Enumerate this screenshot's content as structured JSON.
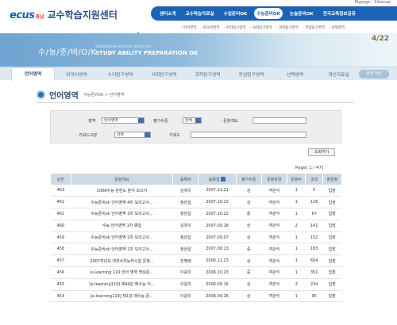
{
  "top_links": [
    "Mypage",
    "Sitemap"
  ],
  "logo": {
    "brand": "ecus",
    "region": "충남",
    "center": "교수학습지원센터"
  },
  "main_nav": [
    "센터소개",
    "교수학습자료실",
    "수업준비OK",
    "수능준비OK",
    "논술준비OK",
    "전국교육정보공유"
  ],
  "main_nav_active": 3,
  "sub_nav": [
    "· 언어영역",
    "· 외국어영역",
    "· 수리탐구영역",
    "· 사회탐구영역",
    "· 과학탐구영역",
    "· 직업탐구영역",
    "· 선택영역"
  ],
  "banner": {
    "ko": "수/능/준/비/O/K",
    "en_small": "Standardized scholastic ability test",
    "en": "STUDY ABILITY PREPARATION OK",
    "math": "4/22"
  },
  "tabs": [
    "언어영역",
    "외국어영역",
    "수리탐구영역",
    "사회탐구영역",
    "과학탐구영역",
    "직업탐구영역",
    "선택영역",
    "개인자료실"
  ],
  "tab_active": 0,
  "write_button": "문항 작성",
  "page_title": "언어영역",
  "breadcrumb": "수능준비OK > 언어영역",
  "search": {
    "area_label": "· 영역",
    "area_value": "언어영역",
    "level_label": "· 평가수준",
    "level_value": "전체",
    "summary_label": "· 문항개요",
    "keyword_type_label": "· 키워드구분",
    "keyword_type_value": "선택",
    "keyword_label": "· 키워드",
    "submit": "조회하기"
  },
  "page_info": "Page[ 1 / 47]",
  "table": {
    "headers": [
      "순번",
      "문항개요",
      "등록자",
      "등록일",
      "평가수준",
      "문항유형",
      "문항수",
      "조회",
      "출문항"
    ],
    "rows": [
      [
        "463",
        "2008수능 관련도 분석 보고서",
        "김유미",
        "2007.11.21",
        "상",
        "객관식",
        "1",
        "5",
        "입장"
      ],
      [
        "462",
        "수능준비ok 언어영역 4차 모의고사...",
        "정완섭",
        "2007.10.23",
        "상",
        "객관식",
        "1",
        "126",
        "입장"
      ],
      [
        "461",
        "수능준비ok 언어영역 3차 모의고사...",
        "정완섭",
        "2007.10.22",
        "중",
        "객관식",
        "1",
        "67",
        "입장"
      ],
      [
        "460",
        "수능 언어영역 1차 종합",
        "김유미",
        "2007.09.18",
        "상",
        "객관식",
        "2",
        "141",
        "입장"
      ],
      [
        "459",
        "수능준비ok 언어영역 2차 모의고사...",
        "정완섭",
        "2007.09.07",
        "상",
        "객관식",
        "1",
        "152",
        "입장"
      ],
      [
        "458",
        "수능준비ok 언어영역 1차 모의고사...",
        "정완섭",
        "2007.08.13",
        "중",
        "객관식",
        "1",
        "183",
        "입장"
      ],
      [
        "457",
        "2007학년도 대학수학능력시험 문항...",
        "전명배",
        "2006.11.23",
        "상",
        "객관식",
        "1",
        "654",
        "입장"
      ],
      [
        "456",
        "e-Learning 119 언어 영역 핵심문...",
        "이윤미",
        "2006.10.23",
        "중",
        "객관식",
        "1",
        "351",
        "입장"
      ],
      [
        "455",
        "[e-learning119] 제44강 매수능 어...",
        "이윤미",
        "2006.09.16",
        "상",
        "객관식",
        "3",
        "234",
        "입장"
      ],
      [
        "454",
        "[e-learning119] 제1강 매수능 문...",
        "이윤미",
        "2006.09.16",
        "상",
        "객관식",
        "1",
        "95",
        "입장"
      ]
    ]
  }
}
